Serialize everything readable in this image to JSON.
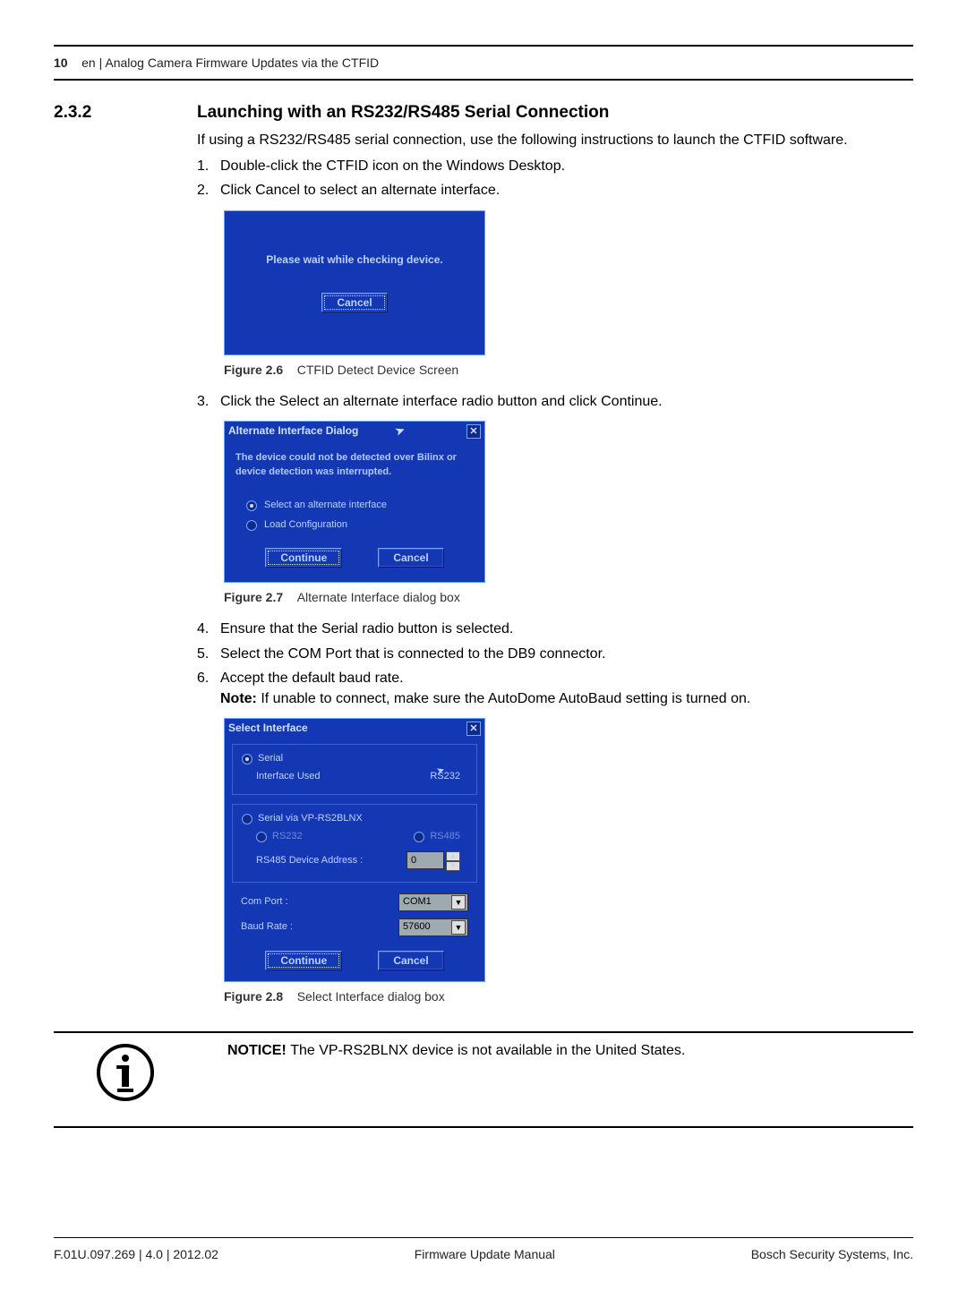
{
  "header": {
    "page_num": "10",
    "rest": "en | Analog Camera Firmware Updates via the CTFID"
  },
  "section": {
    "num": "2.3.2",
    "title": "Launching with an RS232/RS485 Serial Connection",
    "intro": "If using a RS232/RS485 serial connection, use the following instructions to launch the CTFID software.",
    "step1": "Double-click the CTFID icon on the Windows Desktop.",
    "step2": "Click Cancel to select an alternate interface.",
    "step3": "Click the Select an alternate interface radio button and click Continue.",
    "step4": "Ensure that the Serial radio button is selected.",
    "step5": "Select the COM Port that is connected to the DB9 connector.",
    "step6_line1": "Accept the default baud rate.",
    "step6_note_label": "Note:",
    "step6_note_text": " If unable to connect, make sure the AutoDome AutoBaud setting is turned on."
  },
  "fig26": {
    "message": "Please wait while checking device.",
    "cancel": "Cancel",
    "caption_label": "Figure  2.6",
    "caption_text": "CTFID Detect Device Screen"
  },
  "fig27": {
    "title": "Alternate Interface Dialog",
    "msg": "The device could not be detected over Bilinx or device detection was interrupted.",
    "opt1": "Select an alternate interface",
    "opt2": "Load Configuration",
    "continue": "Continue",
    "cancel": "Cancel",
    "caption_label": "Figure  2.7",
    "caption_text": "Alternate Interface dialog box"
  },
  "fig28": {
    "title": "Select Interface",
    "serial": "Serial",
    "iface_used": "Interface Used",
    "iface_val": "RS232",
    "serial_vp": "Serial via VP-RS2BLNX",
    "rs232": "RS232",
    "rs485": "RS485",
    "addr_label": "RS485 Device Address :",
    "addr_val": "0",
    "com_label": "Com Port :",
    "com_val": "COM1",
    "baud_label": "Baud Rate :",
    "baud_val": "57600",
    "continue": "Continue",
    "cancel": "Cancel",
    "caption_label": "Figure  2.8",
    "caption_text": "Select Interface dialog box"
  },
  "notice": {
    "label": "NOTICE! ",
    "text": "The VP-RS2BLNX device is not available in the United States."
  },
  "footer": {
    "left": "F.01U.097.269 | 4.0 | 2012.02",
    "center": "Firmware Update Manual",
    "right": "Bosch Security Systems, Inc."
  }
}
